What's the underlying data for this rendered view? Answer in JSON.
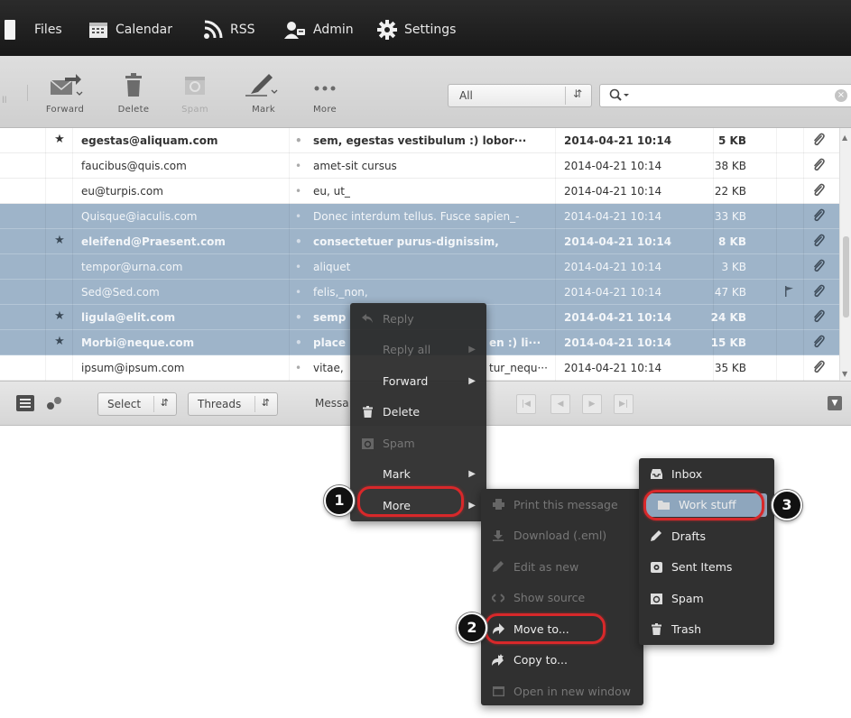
{
  "nav": {
    "items": [
      {
        "label": "Files",
        "icon": "file-icon"
      },
      {
        "label": "Calendar",
        "icon": "calendar-icon"
      },
      {
        "label": "RSS",
        "icon": "rss-icon"
      },
      {
        "label": "Admin",
        "icon": "admin-icon"
      },
      {
        "label": "Settings",
        "icon": "gear-icon"
      }
    ]
  },
  "toolbar": {
    "reply_all_partial": "ll",
    "forward": "Forward",
    "delete": "Delete",
    "spam": "Spam",
    "mark": "Mark",
    "more": "More",
    "filter_value": "All",
    "search_placeholder": "",
    "search_value": ""
  },
  "messages": [
    {
      "from": "egestas@aliquam.com",
      "subject": "sem, egestas vestibulum :) lobor···",
      "date": "2014-04-21 10:14",
      "size": "5 KB",
      "flagged": true,
      "unread": true,
      "selected": false,
      "flag": false
    },
    {
      "from": "faucibus@quis.com",
      "subject": "amet-sit cursus",
      "date": "2014-04-21 10:14",
      "size": "38 KB",
      "flagged": false,
      "unread": false,
      "selected": false,
      "flag": false
    },
    {
      "from": "eu@turpis.com",
      "subject": "eu, ut_",
      "date": "2014-04-21 10:14",
      "size": "22 KB",
      "flagged": false,
      "unread": false,
      "selected": false,
      "flag": false
    },
    {
      "from": "Quisque@iaculis.com",
      "subject": "Donec interdum tellus. Fusce sapien_-",
      "date": "2014-04-21 10:14",
      "size": "33 KB",
      "flagged": false,
      "unread": false,
      "selected": true,
      "flag": false
    },
    {
      "from": "eleifend@Praesent.com",
      "subject": "consectetuer purus-dignissim,",
      "date": "2014-04-21 10:14",
      "size": "8 KB",
      "flagged": true,
      "unread": true,
      "selected": true,
      "flag": false
    },
    {
      "from": "tempor@urna.com",
      "subject": "aliquet",
      "date": "2014-04-21 10:14",
      "size": "3 KB",
      "flagged": false,
      "unread": false,
      "selected": true,
      "flag": false
    },
    {
      "from": "Sed@Sed.com",
      "subject": "felis,_non,",
      "date": "2014-04-21 10:14",
      "size": "47 KB",
      "flagged": false,
      "unread": false,
      "selected": true,
      "flag": true
    },
    {
      "from": "ligula@elit.com",
      "subject": "semp",
      "date": "2014-04-21 10:14",
      "size": "24 KB",
      "flagged": true,
      "unread": true,
      "selected": true,
      "flag": false
    },
    {
      "from": "Morbi@neque.com",
      "subject": "place",
      "date": "2014-04-21 10:14",
      "size": "15 KB",
      "flagged": true,
      "unread": true,
      "selected": true,
      "flag": false
    },
    {
      "from": "ipsum@ipsum.com",
      "subject": "vitae,",
      "date": "2014-04-21 10:14",
      "size": "35 KB",
      "flagged": false,
      "unread": false,
      "selected": false,
      "flag": false
    }
  ],
  "under_menu_text": {
    "row9_subject_tail": "en :) li···",
    "row10_subject_tail": "tur_nequ···"
  },
  "list_footer": {
    "select_label": "Select",
    "threads_label": "Threads",
    "messages_partial": "Messa"
  },
  "context_menu": {
    "items": [
      {
        "label": "Reply",
        "icon": "reply-icon",
        "disabled": true,
        "submenu": false
      },
      {
        "label": "Reply all",
        "icon": "",
        "disabled": true,
        "submenu": true
      },
      {
        "label": "Forward",
        "icon": "",
        "disabled": false,
        "submenu": true
      },
      {
        "label": "Delete",
        "icon": "trash-icon",
        "disabled": false,
        "submenu": false
      },
      {
        "label": "Spam",
        "icon": "spam-icon",
        "disabled": true,
        "submenu": false
      },
      {
        "label": "Mark",
        "icon": "",
        "disabled": false,
        "submenu": true
      },
      {
        "label": "More",
        "icon": "",
        "disabled": false,
        "submenu": true
      }
    ]
  },
  "more_menu": {
    "items": [
      {
        "label": "Print this message",
        "icon": "print-icon",
        "disabled": true
      },
      {
        "label": "Download (.eml)",
        "icon": "download-icon",
        "disabled": true
      },
      {
        "label": "Edit as new",
        "icon": "edit-icon",
        "disabled": true
      },
      {
        "label": "Show source",
        "icon": "code-icon",
        "disabled": true
      },
      {
        "label": "Move to...",
        "icon": "move-icon",
        "disabled": false
      },
      {
        "label": "Copy to...",
        "icon": "copy-icon",
        "disabled": false
      },
      {
        "label": "Open in new window",
        "icon": "window-icon",
        "disabled": true
      }
    ]
  },
  "folder_menu": {
    "items": [
      {
        "label": "Inbox",
        "icon": "inbox-icon"
      },
      {
        "label": "Work stuff",
        "icon": "folder-icon"
      },
      {
        "label": "Drafts",
        "icon": "pencil-icon"
      },
      {
        "label": "Sent Items",
        "icon": "sent-icon"
      },
      {
        "label": "Spam",
        "icon": "spam-icon"
      },
      {
        "label": "Trash",
        "icon": "trash-icon"
      }
    ]
  },
  "callouts": [
    "1",
    "2",
    "3"
  ],
  "colors": {
    "topbar": "#1f1f1f",
    "selected_row": "#9eb4c9",
    "menu_bg": "#303030",
    "highlight_ring": "#d8282a",
    "folder_highlight": "#8ea6bd"
  }
}
